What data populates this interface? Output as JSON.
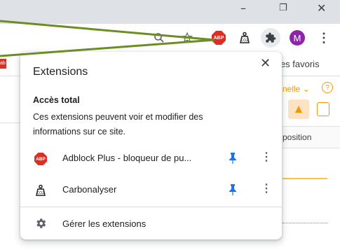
{
  "window": {
    "minimize_glyph": "–",
    "restore_glyph": "❐",
    "close_glyph": "✕"
  },
  "toolbar": {
    "zoom_icon": "zoom-icon",
    "star_icon": "star-icon",
    "adblock_badge": "ABP",
    "avatar_letter": "M",
    "menu_glyph": "⋮"
  },
  "bookmarks": {
    "favorites_label": "tres favoris",
    "left_badge": "ab"
  },
  "page": {
    "link_fragment": "nelle ⌄",
    "help_glyph": "?",
    "column_header": "position"
  },
  "popup": {
    "title": "Extensions",
    "close_glyph": "✕",
    "section_title": "Accès total",
    "section_desc": "Ces extensions peuvent voir et modifier des informations sur ce site.",
    "items": [
      {
        "name": "Adblock Plus - bloqueur de pu...",
        "icon": "adblock-plus-icon",
        "badge": "ABP",
        "pinned": true,
        "more": "⋮"
      },
      {
        "name": "Carbonalyser",
        "icon": "carbonalyser-icon",
        "pinned": true,
        "more": "⋮"
      }
    ],
    "manage_label": "Gérer les extensions"
  },
  "colors": {
    "accent_blue": "#1a73e8",
    "annotation_green": "#6b8e23",
    "adblock_red": "#d93025",
    "avatar_purple": "#8e24aa",
    "page_orange": "#f29900"
  }
}
